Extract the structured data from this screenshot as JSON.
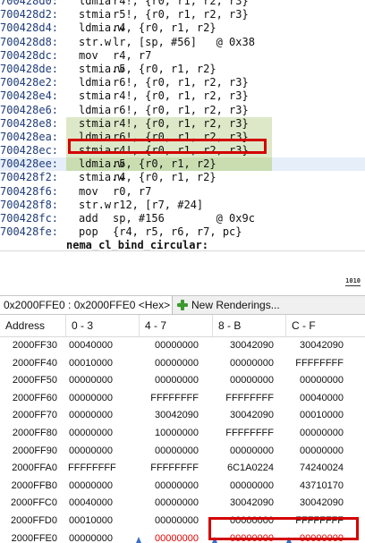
{
  "disassembly": {
    "lines": [
      {
        "addr": "700428d0:",
        "mnem": "ldmia",
        "ops": "r4!, {r0, r1, r2, r3}"
      },
      {
        "addr": "700428d2:",
        "mnem": "stmia",
        "ops": "r5!, {r0, r1, r2, r3}"
      },
      {
        "addr": "700428d4:",
        "mnem": "ldmia.w",
        "ops": "r4, {r0, r1, r2}"
      },
      {
        "addr": "700428d8:",
        "mnem": "str.w",
        "ops": "lr, [sp, #56]   @ 0x38"
      },
      {
        "addr": "700428dc:",
        "mnem": "mov",
        "ops": "r4, r7"
      },
      {
        "addr": "700428de:",
        "mnem": "stmia.w",
        "ops": "r5, {r0, r1, r2}"
      },
      {
        "addr": "700428e2:",
        "mnem": "ldmia",
        "ops": "r6!, {r0, r1, r2, r3}"
      },
      {
        "addr": "700428e4:",
        "mnem": "stmia",
        "ops": "r4!, {r0, r1, r2, r3}"
      },
      {
        "addr": "700428e6:",
        "mnem": "ldmia",
        "ops": "r6!, {r0, r1, r2, r3}"
      },
      {
        "addr": "700428e8:",
        "mnem": "stmia",
        "ops": "r4!, {r0, r1, r2, r3}"
      },
      {
        "addr": "700428ea:",
        "mnem": "ldmia",
        "ops": "r6!, {r0, r1, r2, r3}"
      },
      {
        "addr": "700428ec:",
        "mnem": "stmia",
        "ops": "r4!, {r0, r1, r2, r3}"
      },
      {
        "addr": "700428ee:",
        "mnem": "ldmia.w",
        "ops": "r5, {r0, r1, r2}"
      },
      {
        "addr": "700428f2:",
        "mnem": "stmia.w",
        "ops": "r4, {r0, r1, r2}"
      },
      {
        "addr": "700428f6:",
        "mnem": "mov",
        "ops": "r0, r7"
      },
      {
        "addr": "700428f8:",
        "mnem": "str.w",
        "ops": "r12, [r7, #24]"
      },
      {
        "addr": "700428fc:",
        "mnem": "add",
        "ops": "sp, #156        @ 0x9c"
      },
      {
        "addr": "700428fe:",
        "mnem": "pop",
        "ops": "{r4, r5, r6, r7, pc}"
      }
    ],
    "label": "nema_cl_bind_circular:"
  },
  "toggle_icon": "1010",
  "memory": {
    "tab_label": "0x2000FFE0 : 0x2000FFE0 <Hex>",
    "tab_close": "×",
    "new_renderings_label": "New Renderings...",
    "headers": [
      "Address",
      "0 - 3",
      "4 - 7",
      "8 - B",
      "C - F"
    ],
    "rows": [
      {
        "addr": "2000FF30",
        "cells": [
          "00040000",
          "00000000",
          "30042090",
          "30042090"
        ]
      },
      {
        "addr": "2000FF40",
        "cells": [
          "00010000",
          "00000000",
          "00000000",
          "FFFFFFFF"
        ]
      },
      {
        "addr": "2000FF50",
        "cells": [
          "00000000",
          "00000000",
          "00000000",
          "00000000"
        ]
      },
      {
        "addr": "2000FF60",
        "cells": [
          "00000000",
          "FFFFFFFF",
          "FFFFFFFF",
          "00040000"
        ]
      },
      {
        "addr": "2000FF70",
        "cells": [
          "00000000",
          "30042090",
          "30042090",
          "00010000"
        ]
      },
      {
        "addr": "2000FF80",
        "cells": [
          "00000000",
          "10000000",
          "FFFFFFFF",
          "00000000"
        ]
      },
      {
        "addr": "2000FF90",
        "cells": [
          "00000000",
          "00000000",
          "00000000",
          "00000000"
        ]
      },
      {
        "addr": "2000FFA0",
        "cells": [
          "FFFFFFFF",
          "FFFFFFFF",
          "6C1A0224",
          "74240024"
        ]
      },
      {
        "addr": "2000FFB0",
        "cells": [
          "00000000",
          "00000000",
          "00000000",
          "43710170"
        ]
      },
      {
        "addr": "2000FFC0",
        "cells": [
          "00040000",
          "00000000",
          "30042090",
          "30042090"
        ]
      },
      {
        "addr": "2000FFD0",
        "cells": [
          "00010000",
          "00000000",
          "00000000",
          "FFFFFFFF"
        ]
      },
      {
        "addr": "2000FFE0",
        "cells": [
          "00000000",
          "00000000",
          "00000000",
          "00000000"
        ]
      }
    ]
  },
  "colors": {
    "highlight_box": "#d40000",
    "changed_value": "#e00000",
    "current_line": "#c9ddb0"
  }
}
